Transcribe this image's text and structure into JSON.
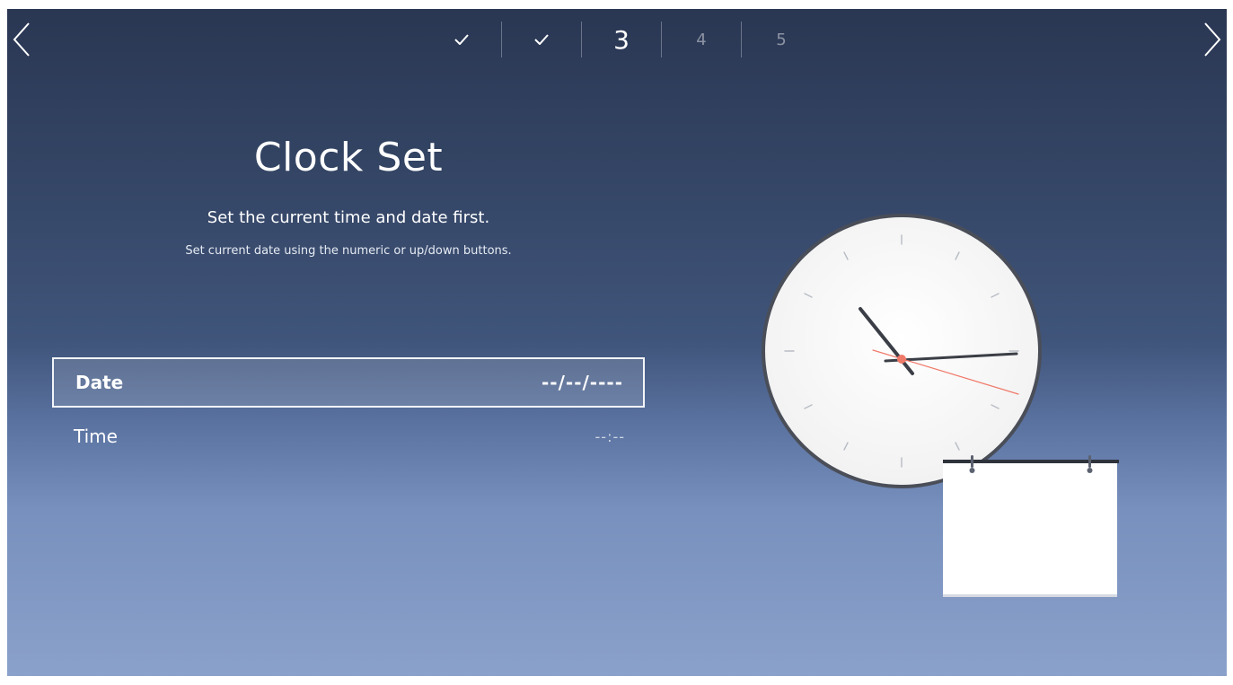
{
  "nav": {
    "prev_icon": "chevron-left-icon",
    "next_icon": "chevron-right-icon",
    "steps": [
      {
        "label": "",
        "state": "done",
        "icon": "check-icon"
      },
      {
        "label": "",
        "state": "done",
        "icon": "check-icon"
      },
      {
        "label": "3",
        "state": "current"
      },
      {
        "label": "4",
        "state": "upcoming"
      },
      {
        "label": "5",
        "state": "upcoming"
      }
    ]
  },
  "page": {
    "title": "Clock Set",
    "subtitle": "Set the current time and date first.",
    "hint": "Set current date using the numeric or up/down buttons."
  },
  "settings": {
    "date": {
      "label": "Date",
      "value": "--/--/----",
      "focused": true
    },
    "time": {
      "label": "Time",
      "value": "--:--",
      "focused": false
    }
  },
  "illustration": {
    "clock_icon": "clock-icon",
    "calendar_icon": "calendar-icon"
  },
  "colors": {
    "background_top": "#2a3753",
    "background_bottom": "#8aa1cb",
    "text": "#ffffff",
    "clock_second_hand": "#f07a6a"
  }
}
